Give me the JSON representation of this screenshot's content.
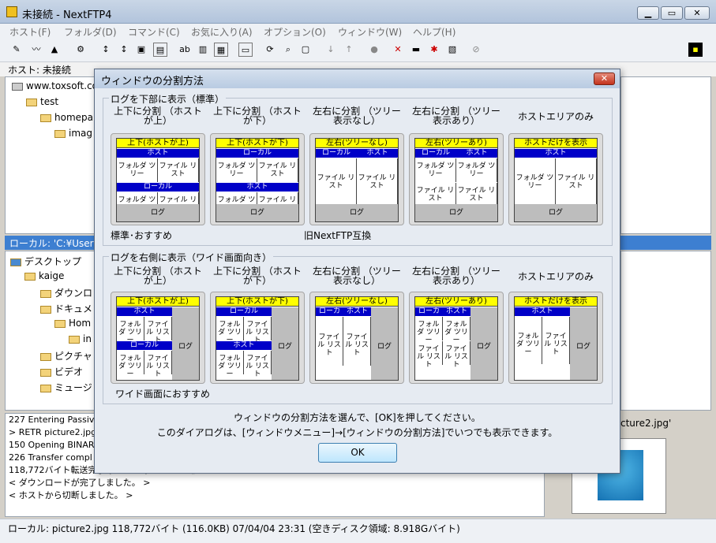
{
  "window": {
    "title": "未接続 - NextFTP4",
    "min": "▁",
    "max": "▭",
    "close": "✕"
  },
  "menu": [
    "ホスト(F)",
    "フォルダ(D)",
    "コマンド(C)",
    "お気に入り(A)",
    "オプション(O)",
    "ウィンドウ(W)",
    "ヘルプ(H)"
  ],
  "hostbar": "ホスト: 未接続",
  "host_tree": [
    "www.toxsoft.co",
    "test",
    "homepa",
    "imag"
  ],
  "local_header": "ローカル: 'C:¥User",
  "local_tree": [
    "デスクトップ",
    "kaige",
    "ダウンロ",
    "ドキュメ",
    "Hom",
    "in",
    "ピクチャ",
    "ビデオ",
    "ミュージ"
  ],
  "log": [
    "227 Entering Passiv",
    "> RETR picture2.jpg",
    "150 Opening BINAR",
    "226 Transfer compl",
    "118,772バイト転送完了 (00:00.3) 444.4KB/秒",
    "< ダウンロードが完了しました。 >",
    "< ホストから切断しました。 >"
  ],
  "preview_name": "cture2.jpg'",
  "status": "ローカル: picture2.jpg  118,772バイト (116.0KB)  07/04/04 23:31  (空きディスク領域: 8.918Gバイト)",
  "dialog": {
    "title": "ウィンドウの分割方法",
    "group1": "ログを下部に表示（標準）",
    "group2": "ログを右側に表示（ワイド画面向き）",
    "labels": [
      "上下に分割\n（ホストが上）",
      "上下に分割\n（ホストが下）",
      "左右に分割\n（ツリー表示なし）",
      "左右に分割\n（ツリー表示あり）",
      "ホストエリアのみ"
    ],
    "yellow": [
      "上下(ホストが上)",
      "上下(ホストが下)",
      "左右(ツリーなし)",
      "左右(ツリーあり)",
      "ホストだけを表示"
    ],
    "host": "ホスト",
    "local": "ローカル",
    "folder_tree": "フォルダ\nツリー",
    "file_list": "ファイル\nリスト",
    "log": "ログ",
    "note1": "標準･おすすめ",
    "note2": "旧NextFTP互換",
    "note3": "ワイド画面におすすめ",
    "foot1": "ウィンドウの分割方法を選んで、[OK]を押してください。",
    "foot2": "このダイアログは、[ウィンドウメニュー]→[ウィンドウの分割方法]でいつでも表示できます。",
    "ok": "OK"
  }
}
